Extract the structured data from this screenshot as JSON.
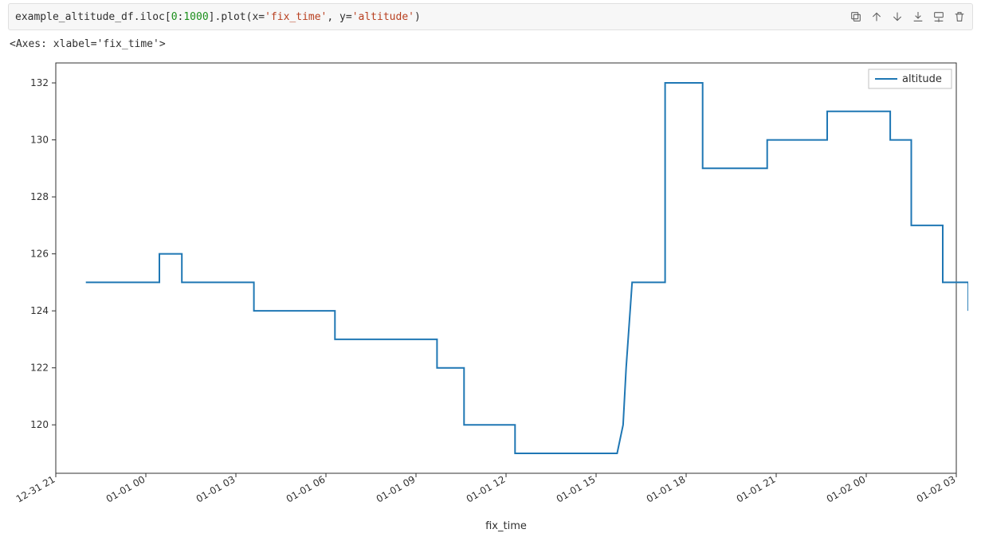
{
  "code": {
    "i1": "example_altitude_df",
    "p1": ".",
    "i2": "iloc",
    "p2": "[",
    "n1": "0",
    "p3": ":",
    "n2": "1000",
    "p4": "].",
    "i3": "plot",
    "p5": "(",
    "i4": "x",
    "p6": "=",
    "s1": "'fix_time'",
    "p7": ", ",
    "i5": "y",
    "p8": "=",
    "s2": "'altitude'",
    "p9": ")"
  },
  "output_repr": "<Axes: xlabel='fix_time'>",
  "chart_data": {
    "type": "line",
    "xlabel": "fix_time",
    "ylabel": "",
    "legend": [
      "altitude"
    ],
    "legend_position": "upper right",
    "x_ticks": [
      "12-31 21",
      "01-01 00",
      "01-01 03",
      "01-01 06",
      "01-01 09",
      "01-01 12",
      "01-01 15",
      "01-01 18",
      "01-01 21",
      "01-02 00",
      "01-02 03"
    ],
    "ylim": [
      118.3,
      132.7
    ],
    "y_ticks": [
      120,
      122,
      124,
      126,
      128,
      130,
      132
    ],
    "series": [
      {
        "name": "altitude",
        "color": "#1f77b4",
        "points": [
          {
            "x": -2.0,
            "y": 125
          },
          {
            "x": 0.45,
            "y": 125
          },
          {
            "x": 0.45,
            "y": 126
          },
          {
            "x": 1.2,
            "y": 126
          },
          {
            "x": 1.2,
            "y": 125
          },
          {
            "x": 3.6,
            "y": 125
          },
          {
            "x": 3.6,
            "y": 124
          },
          {
            "x": 6.3,
            "y": 124
          },
          {
            "x": 6.3,
            "y": 123
          },
          {
            "x": 9.7,
            "y": 123
          },
          {
            "x": 9.7,
            "y": 122
          },
          {
            "x": 10.6,
            "y": 122
          },
          {
            "x": 10.6,
            "y": 120
          },
          {
            "x": 12.3,
            "y": 120
          },
          {
            "x": 12.3,
            "y": 119
          },
          {
            "x": 15.7,
            "y": 119
          },
          {
            "x": 15.9,
            "y": 120
          },
          {
            "x": 16.0,
            "y": 122
          },
          {
            "x": 16.2,
            "y": 125
          },
          {
            "x": 17.3,
            "y": 125
          },
          {
            "x": 17.3,
            "y": 132
          },
          {
            "x": 18.55,
            "y": 132
          },
          {
            "x": 18.55,
            "y": 129
          },
          {
            "x": 20.7,
            "y": 129
          },
          {
            "x": 20.7,
            "y": 130
          },
          {
            "x": 22.7,
            "y": 130
          },
          {
            "x": 22.7,
            "y": 131
          },
          {
            "x": 24.8,
            "y": 131
          },
          {
            "x": 24.8,
            "y": 130
          },
          {
            "x": 25.5,
            "y": 130
          },
          {
            "x": 25.5,
            "y": 127
          },
          {
            "x": 26.55,
            "y": 127
          },
          {
            "x": 26.55,
            "y": 125
          },
          {
            "x": 27.4,
            "y": 125
          },
          {
            "x": 27.4,
            "y": 124
          }
        ]
      }
    ],
    "x_range_hours": [
      -3,
      27
    ]
  }
}
